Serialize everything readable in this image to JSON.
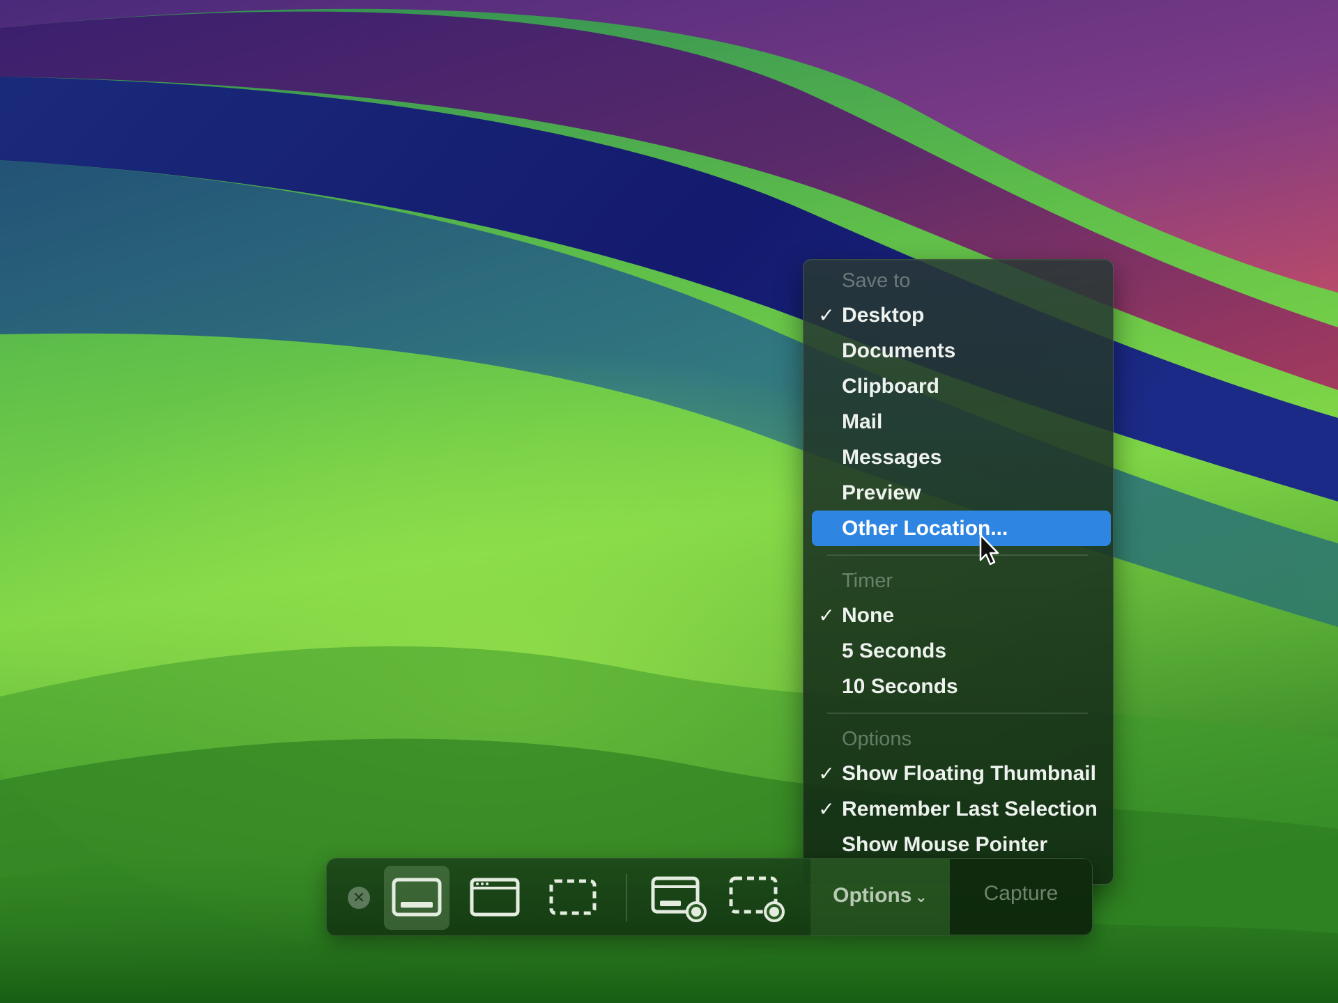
{
  "save_to": {
    "title": "Save to",
    "items": [
      {
        "label": "Desktop",
        "checked": true
      },
      {
        "label": "Documents",
        "checked": false
      },
      {
        "label": "Clipboard",
        "checked": false
      },
      {
        "label": "Mail",
        "checked": false
      },
      {
        "label": "Messages",
        "checked": false
      },
      {
        "label": "Preview",
        "checked": false
      },
      {
        "label": "Other Location...",
        "checked": false,
        "highlighted": true
      }
    ]
  },
  "timer": {
    "title": "Timer",
    "items": [
      {
        "label": "None",
        "checked": true
      },
      {
        "label": "5 Seconds",
        "checked": false
      },
      {
        "label": "10 Seconds",
        "checked": false
      }
    ]
  },
  "options": {
    "title": "Options",
    "items": [
      {
        "label": "Show Floating Thumbnail",
        "checked": true
      },
      {
        "label": "Remember Last Selection",
        "checked": true
      },
      {
        "label": "Show Mouse Pointer",
        "checked": false
      }
    ]
  },
  "check_glyph": "✓",
  "toolbar": {
    "close_glyph": "✕",
    "options_label": "Options",
    "options_chevron": "⌄",
    "capture_label": "Capture",
    "buttons": [
      {
        "name": "capture-entire-screen",
        "icon": "entire-screen-icon",
        "selected": true
      },
      {
        "name": "capture-selected-window",
        "icon": "window-icon",
        "selected": false
      },
      {
        "name": "capture-selected-portion",
        "icon": "selection-icon",
        "selected": false
      },
      {
        "name": "record-entire-screen",
        "icon": "record-screen-icon",
        "selected": false
      },
      {
        "name": "record-selected-portion",
        "icon": "record-selection-icon",
        "selected": false
      }
    ]
  },
  "colors": {
    "highlight": "#2f86e2",
    "menu_text": "#eef2ee",
    "section_title": "#8f9a94"
  }
}
